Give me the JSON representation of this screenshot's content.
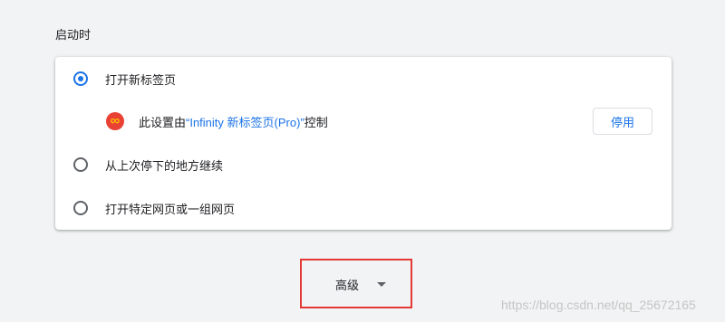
{
  "section": {
    "title": "启动时"
  },
  "options": [
    {
      "label": "打开新标签页",
      "checked": true
    },
    {
      "label": "从上次停下的地方继续",
      "checked": false
    },
    {
      "label": "打开特定网页或一组网页",
      "checked": false
    }
  ],
  "extension_notice": {
    "icon": "infinity-icon",
    "icon_glyph": "∞",
    "prefix": "此设置由",
    "link_text": "“Infinity 新标签页(Pro)”",
    "suffix": "控制",
    "disable_label": "停用"
  },
  "advanced": {
    "label": "高级",
    "icon": "chevron-down-icon"
  },
  "watermark": {
    "text": "https://blog.csdn.net/qq_25672165"
  },
  "colors": {
    "accent": "#1a73e8",
    "highlight_box": "#e53935",
    "extension_icon_bg": "#e94235",
    "extension_icon_fg": "#fbbc04"
  }
}
